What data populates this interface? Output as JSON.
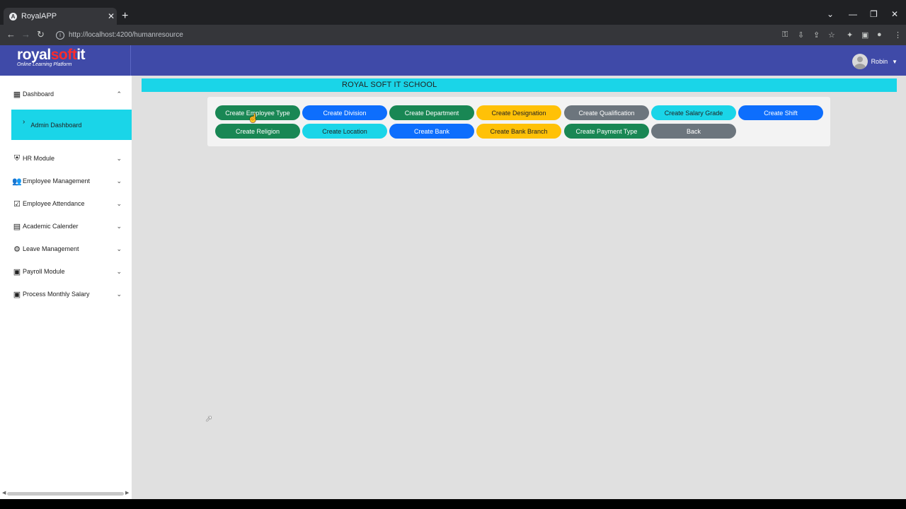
{
  "browser": {
    "tab_title": "RoyalAPP",
    "tab_icon": "angular-icon",
    "url": "http://localhost:4200/humanresource"
  },
  "header": {
    "logo_part1": "royal",
    "logo_part2": "soft",
    "logo_part3": "it",
    "logo_sub": "Online Learning Platform",
    "user_name": "Robin",
    "bg_color": "#3f4aa8"
  },
  "sidebar": {
    "items": [
      {
        "label": "Dashboard",
        "icon": "dashboard-icon"
      },
      {
        "label": "Admin Dashboard",
        "icon": "chevron-right-icon"
      },
      {
        "label": "HR Module",
        "icon": "admin-shield-icon"
      },
      {
        "label": "Employee Management",
        "icon": "people-icon"
      },
      {
        "label": "Employee Attendance",
        "icon": "calendar-check-icon"
      },
      {
        "label": "Academic Calender",
        "icon": "calendar-icon"
      },
      {
        "label": "Leave Management",
        "icon": "gear-icon"
      },
      {
        "label": "Payroll Module",
        "icon": "payments-icon"
      },
      {
        "label": "Process Monthly Salary",
        "icon": "payments-icon"
      }
    ]
  },
  "main": {
    "banner_title": "ROYAL SOFT IT SCHOOL",
    "banner_color": "#1ad5e8",
    "buttons": [
      {
        "label": "Create Employee Type",
        "color": "green"
      },
      {
        "label": "Create Division",
        "color": "blue"
      },
      {
        "label": "Create Department",
        "color": "green"
      },
      {
        "label": "Create Designation",
        "color": "yellow"
      },
      {
        "label": "Create Qualification",
        "color": "gray"
      },
      {
        "label": "Create Salary Grade",
        "color": "cyan"
      },
      {
        "label": "Create Shift",
        "color": "blue"
      },
      {
        "label": "Create Religion",
        "color": "green"
      },
      {
        "label": "Create Location",
        "color": "cyan"
      },
      {
        "label": "Create Bank",
        "color": "blue"
      },
      {
        "label": "Create Bank Branch",
        "color": "yellow"
      },
      {
        "label": "Create Payment Type",
        "color": "green"
      },
      {
        "label": "Back",
        "color": "gray"
      }
    ]
  }
}
